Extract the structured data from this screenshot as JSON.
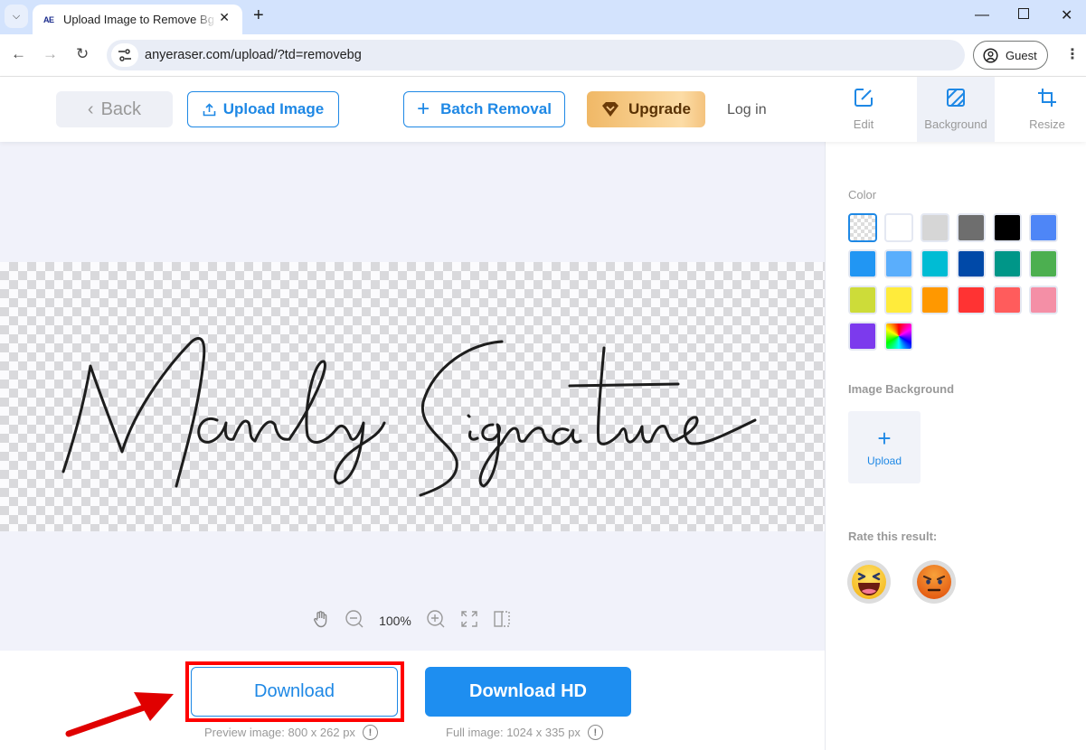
{
  "browser": {
    "tab_title": "Upload Image to Remove Bg",
    "tab_favicon": "AE",
    "url": "anyeraser.com/upload/?td=removebg",
    "profile_label": "Guest",
    "icons": {
      "tab_menu": "chevron-down-icon",
      "tab_close": "close-icon",
      "new_tab": "plus-icon",
      "back": "arrow-left-icon",
      "forward": "arrow-right-icon",
      "reload": "reload-icon",
      "site_info": "tune-icon",
      "profile": "person-circle-icon",
      "menu": "kebab-menu-icon",
      "minimize": "minimize-icon",
      "maximize": "maximize-icon",
      "close_window": "close-icon"
    }
  },
  "header": {
    "back_label": "Back",
    "upload_label": "Upload Image",
    "batch_label": "Batch Removal",
    "upgrade_label": "Upgrade",
    "login_label": "Log in",
    "tools": [
      {
        "label": "Edit",
        "icon": "edit-icon",
        "active": false
      },
      {
        "label": "Background",
        "icon": "background-icon",
        "active": true
      },
      {
        "label": "Resize",
        "icon": "crop-icon",
        "active": false
      }
    ]
  },
  "canvas": {
    "image_text": "Manly Signature",
    "zoom_level": "100%",
    "zoom_tools": [
      "hand-icon",
      "zoom-out-icon",
      "zoom-in-icon",
      "fit-screen-icon",
      "compare-icon"
    ]
  },
  "download": {
    "download_label": "Download",
    "download_hd_label": "Download HD",
    "preview_info": "Preview image: 800 x 262 px",
    "full_info": "Full image: 1024 x 335 px",
    "info_glyph": "!",
    "highlight_color": "#ff0000"
  },
  "panel": {
    "color_label": "Color",
    "colors": [
      {
        "name": "transparent",
        "hex": "transparent",
        "selected": true
      },
      {
        "name": "white",
        "hex": "#ffffff"
      },
      {
        "name": "light-gray",
        "hex": "#d6d6d6"
      },
      {
        "name": "gray",
        "hex": "#6e6e6e"
      },
      {
        "name": "black",
        "hex": "#000000"
      },
      {
        "name": "blue",
        "hex": "#4e86f7"
      },
      {
        "name": "azure",
        "hex": "#2196f3"
      },
      {
        "name": "light-blue",
        "hex": "#5aaefc"
      },
      {
        "name": "cyan",
        "hex": "#00bcd4"
      },
      {
        "name": "navy",
        "hex": "#0049a8"
      },
      {
        "name": "teal",
        "hex": "#009688"
      },
      {
        "name": "green",
        "hex": "#4caf50"
      },
      {
        "name": "lime",
        "hex": "#cddc39"
      },
      {
        "name": "yellow",
        "hex": "#ffeb3b"
      },
      {
        "name": "orange",
        "hex": "#ff9800"
      },
      {
        "name": "red",
        "hex": "#ff3333"
      },
      {
        "name": "coral",
        "hex": "#ff5c5c"
      },
      {
        "name": "pink",
        "hex": "#f48fa6"
      },
      {
        "name": "purple",
        "hex": "#7c3aed"
      },
      {
        "name": "rainbow",
        "hex": "custom"
      }
    ],
    "image_bg_label": "Image Background",
    "upload_label": "Upload",
    "rate_label": "Rate this result:",
    "rate_options": [
      {
        "name": "laughing-face-icon",
        "emoji": "😆"
      },
      {
        "name": "angry-face-icon",
        "emoji": "😡"
      }
    ]
  },
  "accent_color": "#1e88e5"
}
